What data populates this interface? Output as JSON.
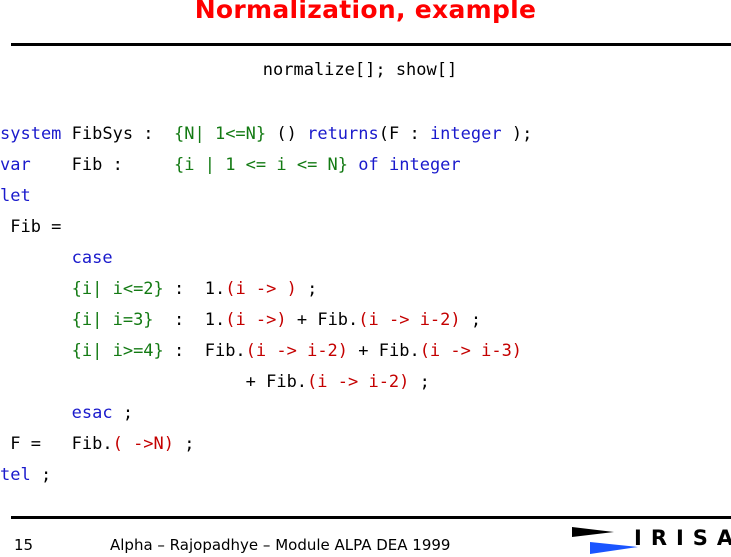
{
  "slide": {
    "title": "Normalization, example",
    "command": "normalize[]; show[]",
    "footer": {
      "page_number": "15",
      "text": "Alpha – Rajopadhye – Module ALPA DEA 1999"
    },
    "logo": {
      "text": "IRISA",
      "colors": {
        "upper_flag": "#000000",
        "lower_flag": "#1a55ff"
      }
    }
  },
  "code": {
    "line1": {
      "kw1": "system",
      "t1": " FibSys :  ",
      "dom": "{N| 1<=N}",
      "t2": " () ",
      "kw2": "returns",
      "t3": "(F : ",
      "kw3": "integer",
      "t4": " );"
    },
    "line2": {
      "kw1": "var",
      "t1": "    Fib :     ",
      "dom": "{i | 1 <= i <= N}",
      "t2": " ",
      "kw2": "of",
      "t3": " ",
      "kw3": "integer"
    },
    "line3": {
      "kw1": "let"
    },
    "line4": {
      "t1": " Fib ="
    },
    "line5": {
      "indent": "       ",
      "kw1": "case"
    },
    "line6": {
      "indent": "       ",
      "dom": "{i| i<=2}",
      "t1": " :  1.",
      "dep": "(i -> )",
      "t2": " ;"
    },
    "line7": {
      "indent": "       ",
      "dom": "{i| i=3}",
      "t1": "  :  1.",
      "dep1": "(i ->)",
      "t2": " + Fib.",
      "dep2": "(i -> i-2)",
      "t3": " ;"
    },
    "line8": {
      "indent": "       ",
      "dom": "{i| i>=4}",
      "t1": " :  Fib.",
      "dep1": "(i -> i-2)",
      "t2": " + Fib.",
      "dep2": "(i -> i-3)"
    },
    "line9": {
      "t1": "                        + Fib.",
      "dep": "(i -> i-2)",
      "t2": " ;"
    },
    "line10": {
      "indent": "       ",
      "kw1": "esac",
      "t1": " ;"
    },
    "line11": {
      "t1": " F =   Fib.",
      "dep": "( ->N)",
      "t2": " ;"
    },
    "line12": {
      "kw1": "tel",
      "t1": " ;"
    }
  },
  "colors": {
    "title": "#ff0000",
    "keyword": "#1a1acc",
    "domain": "#137a13",
    "dependence": "#c40000",
    "text": "#000000"
  }
}
